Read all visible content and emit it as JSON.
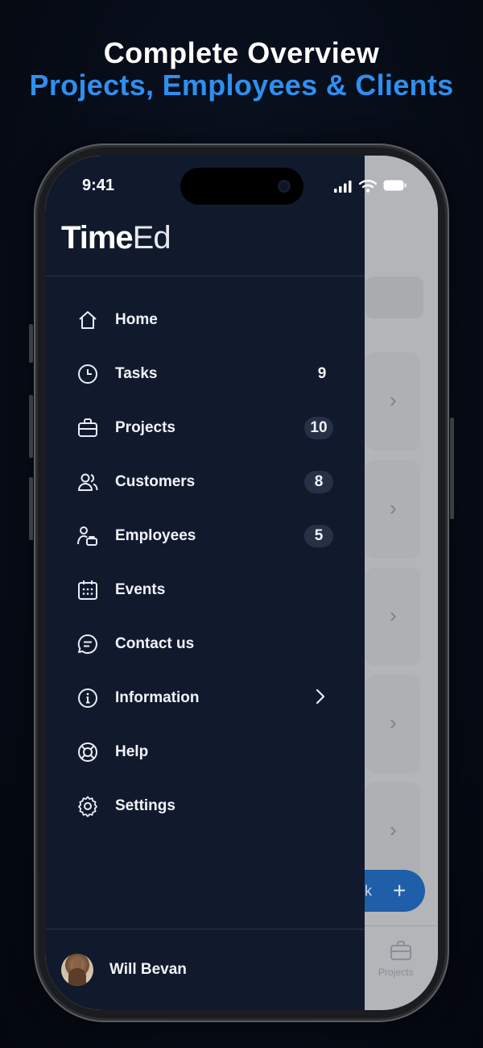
{
  "headline": {
    "line1": "Complete Overview",
    "line2": "Projects, Employees & Clients"
  },
  "status_bar": {
    "time": "9:41"
  },
  "app": {
    "logo_bold": "Time",
    "logo_thin": "Ed"
  },
  "menu": {
    "items": [
      {
        "label": "Home",
        "icon": "home-icon"
      },
      {
        "label": "Tasks",
        "icon": "clock-icon",
        "count": "9"
      },
      {
        "label": "Projects",
        "icon": "briefcase-icon",
        "count": "10"
      },
      {
        "label": "Customers",
        "icon": "users-icon",
        "count": "8"
      },
      {
        "label": "Employees",
        "icon": "employees-icon",
        "count": "5"
      },
      {
        "label": "Events",
        "icon": "calendar-icon"
      },
      {
        "label": "Contact us",
        "icon": "chat-icon"
      },
      {
        "label": "Information",
        "icon": "info-icon"
      },
      {
        "label": "Help",
        "icon": "lifebuoy-icon"
      },
      {
        "label": "Settings",
        "icon": "gear-icon"
      }
    ]
  },
  "user": {
    "name": "Will Bevan"
  },
  "background_app": {
    "fab_label": "sk",
    "tab_label": "Projects"
  },
  "colors": {
    "accent": "#2f8ff0",
    "drawer_bg": "#111a2d",
    "fab": "#1f5ea8"
  }
}
